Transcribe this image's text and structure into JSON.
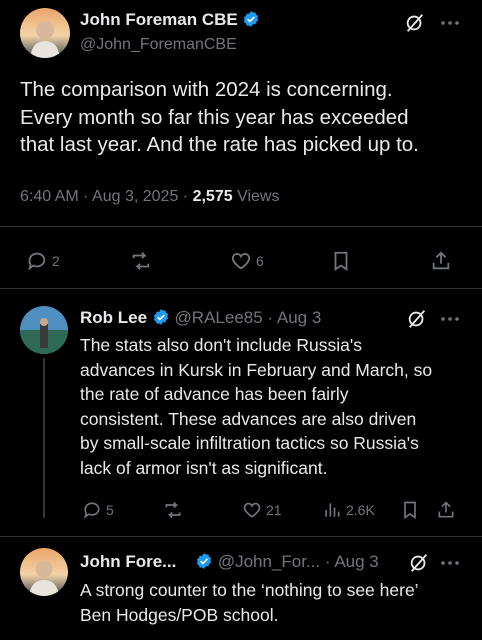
{
  "main_tweet": {
    "author": "John Foreman CBE",
    "handle": "@John_ForemanCBE",
    "text_lines": [
      "The comparison with 2024 is concerning.",
      "Every month so far this year has exceeded",
      "that last year. And the rate has picked up to."
    ],
    "time": "6:40 AM",
    "date": "Aug 3, 2025",
    "views_count": "2,575",
    "views_label": "Views",
    "replies": "2",
    "likes": "6"
  },
  "reply1": {
    "author": "Rob Lee",
    "handle": "@RALee85",
    "date": "Aug 3",
    "text_lines": [
      "The stats also don't include Russia's",
      "advances in Kursk in February and March, so",
      "the rate of advance has been fairly",
      "consistent. These advances are also driven",
      "by small-scale infiltration tactics so Russia's",
      "lack of armor isn't as significant."
    ],
    "replies": "5",
    "likes": "21",
    "views": "2.6K"
  },
  "reply2": {
    "author": "John Fore...",
    "handle": "@John_For...",
    "date": "Aug 3",
    "text_lines": [
      "A strong counter to the ‘nothing to see here’",
      "Ben Hodges/POB school."
    ]
  },
  "separator": "·",
  "colors": {
    "accent": "#1d9bf0",
    "muted": "#71767b",
    "text": "#e7e9ea"
  }
}
